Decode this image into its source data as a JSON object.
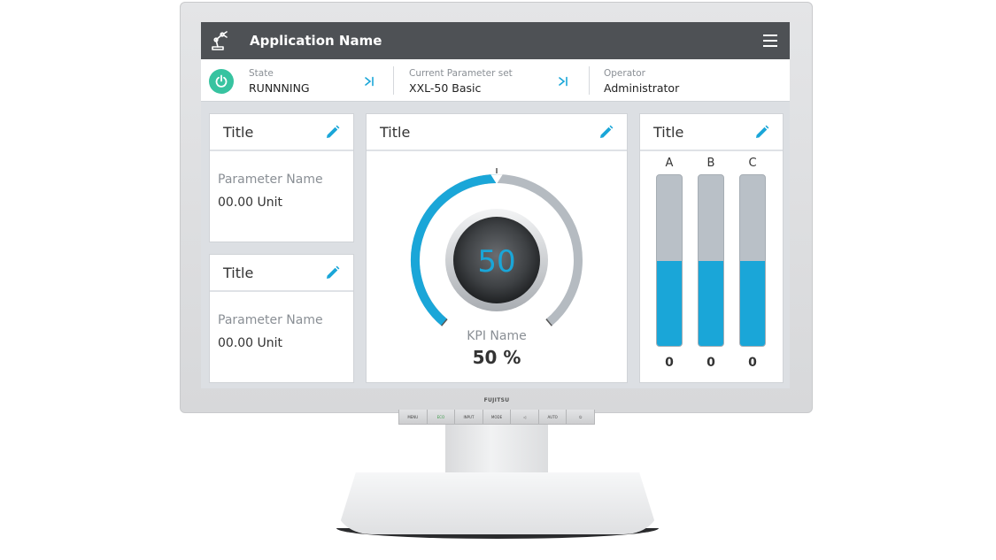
{
  "header": {
    "app_title": "Application Name",
    "logo_icon": "robot-arm-icon",
    "menu_icon": "hamburger-menu-icon"
  },
  "info_bar": {
    "state_label": "State",
    "state_value": "RUNNNING",
    "parameter_label": "Current Parameter set",
    "parameter_value": "XXL-50 Basic",
    "operator_label": "Operator",
    "operator_value": "Administrator",
    "power_icon": "power-icon",
    "skip_icon": "skip-to-end-icon"
  },
  "cards": {
    "top_left": {
      "title": "Title",
      "param_name": "Parameter Name",
      "param_value": "00.00 Unit"
    },
    "bottom_left": {
      "title": "Title",
      "param_name": "Parameter Name",
      "param_value": "00.00 Unit"
    },
    "gauge": {
      "title": "Title",
      "value": "50",
      "percent": 50,
      "kpi_name": "KPI Name",
      "kpi_value": "50 %"
    },
    "bars": {
      "title": "Title",
      "items": [
        {
          "label": "A",
          "value": "0",
          "level": 0.5
        },
        {
          "label": "B",
          "value": "0",
          "level": 0.5
        },
        {
          "label": "C",
          "value": "0",
          "level": 0.5
        }
      ]
    }
  },
  "monitor": {
    "brand": "FUJITSU",
    "buttons": [
      "MENU",
      "ECO",
      "INPUT",
      "MODE",
      "◁",
      "AUTO",
      "⏻"
    ]
  },
  "colors": {
    "accent": "#1aa6d8",
    "header_bg": "#4e5155",
    "power_green": "#37c3a0",
    "gauge_track": "#b5bbc1"
  }
}
